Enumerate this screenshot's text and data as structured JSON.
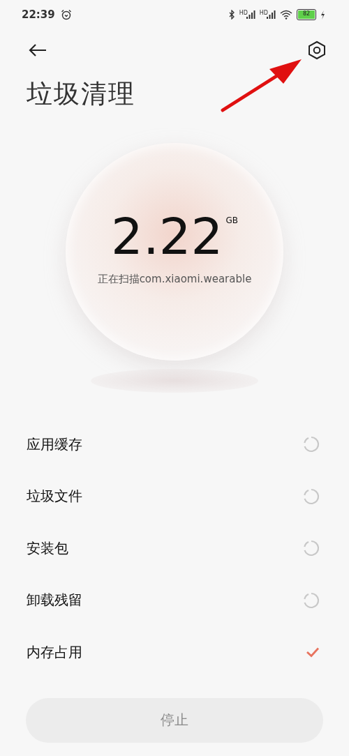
{
  "status_bar": {
    "time": "22:39",
    "signals": [
      {
        "label": "HD"
      },
      {
        "label": "HD"
      }
    ],
    "battery": {
      "text": "82",
      "charging": true
    }
  },
  "header": {
    "title": "垃圾清理"
  },
  "scan": {
    "size": "2.22",
    "unit": "GB",
    "status": "正在扫描com.xiaomi.wearable"
  },
  "items": [
    {
      "label": "应用缓存",
      "kind": "scanning"
    },
    {
      "label": "垃圾文件",
      "kind": "scanning"
    },
    {
      "label": "安装包",
      "kind": "scanning"
    },
    {
      "label": "卸载残留",
      "kind": "scanning"
    },
    {
      "label": "内存占用",
      "kind": "done"
    }
  ],
  "button": {
    "label": "停止"
  },
  "annotation": {
    "kind": "arrow"
  }
}
